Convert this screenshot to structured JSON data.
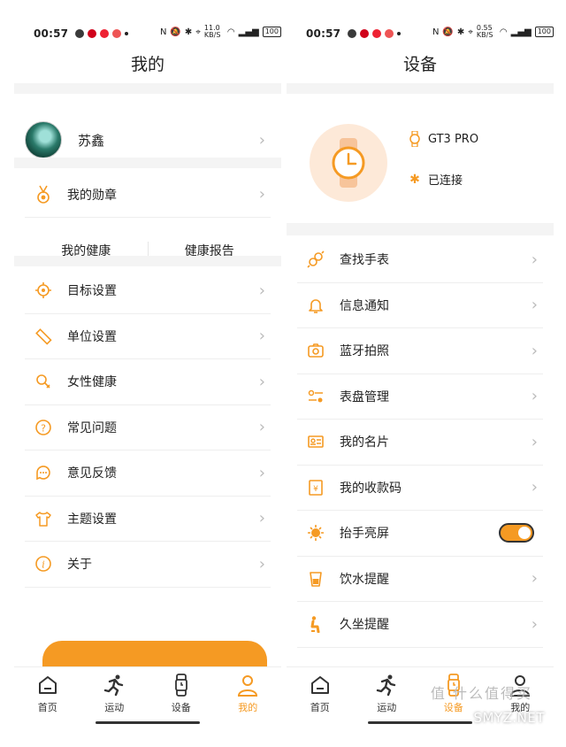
{
  "status": {
    "time": "00:57",
    "net_left": "11.0 KB/S",
    "net_right": "0.55 KB/S",
    "battery": "100"
  },
  "colors": {
    "accent": "#f59a23",
    "band": "#f4f4f4"
  },
  "left": {
    "title": "我的",
    "profile_name": "苏鑫",
    "medal": "我的勋章",
    "health": "我的健康",
    "health_report": "健康报告",
    "menu": [
      {
        "label": "目标设置",
        "icon": "target-icon"
      },
      {
        "label": "单位设置",
        "icon": "ruler-icon"
      },
      {
        "label": "女性健康",
        "icon": "female-icon"
      },
      {
        "label": "常见问题",
        "icon": "question-icon"
      },
      {
        "label": "意见反馈",
        "icon": "feedback-icon"
      },
      {
        "label": "主题设置",
        "icon": "shirt-icon"
      },
      {
        "label": "关于",
        "icon": "info-icon"
      }
    ]
  },
  "right": {
    "title": "设备",
    "device_name": "GT3 PRO",
    "device_status": "已连接",
    "menu": [
      {
        "label": "查找手表",
        "icon": "find-watch-icon"
      },
      {
        "label": "信息通知",
        "icon": "bell-icon"
      },
      {
        "label": "蓝牙拍照",
        "icon": "camera-icon"
      },
      {
        "label": "表盘管理",
        "icon": "dial-manage-icon"
      },
      {
        "label": "我的名片",
        "icon": "card-icon"
      },
      {
        "label": "我的收款码",
        "icon": "payment-code-icon"
      },
      {
        "label": "抬手亮屏",
        "icon": "raise-wake-icon",
        "toggle": true
      },
      {
        "label": "饮水提醒",
        "icon": "cup-icon"
      },
      {
        "label": "久坐提醒",
        "icon": "sit-icon"
      }
    ]
  },
  "tabs": [
    {
      "label": "首页",
      "icon": "home-icon"
    },
    {
      "label": "运动",
      "icon": "run-icon"
    },
    {
      "label": "设备",
      "icon": "watch-icon"
    },
    {
      "label": "我的",
      "icon": "person-icon"
    }
  ],
  "watermark": {
    "text": "SMYZ.NET",
    "top": "值 什么值得买"
  }
}
